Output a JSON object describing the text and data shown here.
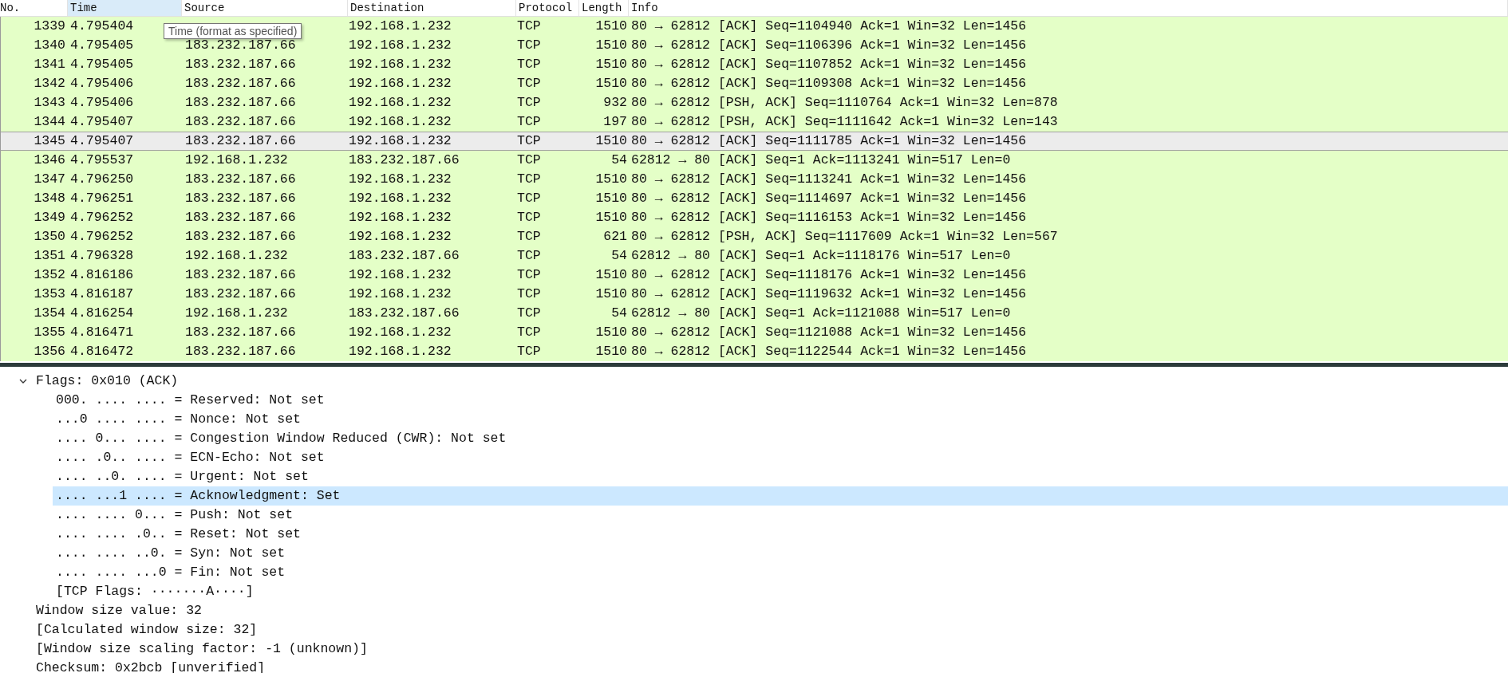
{
  "packet_list": {
    "columns": [
      {
        "label": "No.",
        "selected": false
      },
      {
        "label": "Time",
        "selected": true
      },
      {
        "label": "Source",
        "selected": false
      },
      {
        "label": "Destination",
        "selected": false
      },
      {
        "label": "Protocol",
        "selected": false
      },
      {
        "label": "Length",
        "selected": false
      },
      {
        "label": "Info",
        "selected": false
      }
    ],
    "tooltip": "Time (format as specified)",
    "rows": [
      {
        "no": "1339",
        "time": "4.795404",
        "destination": "192.168.1.232",
        "protocol": "TCP",
        "length": "1510",
        "info": "80 → 62812 [ACK] Seq=1104940 Ack=1 Win=32 Len=1456",
        "selected": false
      },
      {
        "no": "1340",
        "time": "4.795405",
        "source": "183.232.187.66",
        "destination": "192.168.1.232",
        "protocol": "TCP",
        "length": "1510",
        "info": "80 → 62812 [ACK] Seq=1106396 Ack=1 Win=32 Len=1456",
        "selected": false
      },
      {
        "no": "1341",
        "time": "4.795405",
        "source": "183.232.187.66",
        "destination": "192.168.1.232",
        "protocol": "TCP",
        "length": "1510",
        "info": "80 → 62812 [ACK] Seq=1107852 Ack=1 Win=32 Len=1456",
        "selected": false
      },
      {
        "no": "1342",
        "time": "4.795406",
        "source": "183.232.187.66",
        "destination": "192.168.1.232",
        "protocol": "TCP",
        "length": "1510",
        "info": "80 → 62812 [ACK] Seq=1109308 Ack=1 Win=32 Len=1456",
        "selected": false
      },
      {
        "no": "1343",
        "time": "4.795406",
        "source": "183.232.187.66",
        "destination": "192.168.1.232",
        "protocol": "TCP",
        "length": "932",
        "info": "80 → 62812 [PSH, ACK] Seq=1110764 Ack=1 Win=32 Len=878",
        "selected": false
      },
      {
        "no": "1344",
        "time": "4.795407",
        "source": "183.232.187.66",
        "destination": "192.168.1.232",
        "protocol": "TCP",
        "length": "197",
        "info": "80 → 62812 [PSH, ACK] Seq=1111642 Ack=1 Win=32 Len=143",
        "selected": false
      },
      {
        "no": "1345",
        "time": "4.795407",
        "source": "183.232.187.66",
        "destination": "192.168.1.232",
        "protocol": "TCP",
        "length": "1510",
        "info": "80 → 62812 [ACK] Seq=1111785 Ack=1 Win=32 Len=1456",
        "selected": true
      },
      {
        "no": "1346",
        "time": "4.795537",
        "source": "192.168.1.232",
        "destination": "183.232.187.66",
        "protocol": "TCP",
        "length": "54",
        "info": "62812 → 80 [ACK] Seq=1 Ack=1113241 Win=517 Len=0",
        "selected": false
      },
      {
        "no": "1347",
        "time": "4.796250",
        "source": "183.232.187.66",
        "destination": "192.168.1.232",
        "protocol": "TCP",
        "length": "1510",
        "info": "80 → 62812 [ACK] Seq=1113241 Ack=1 Win=32 Len=1456",
        "selected": false
      },
      {
        "no": "1348",
        "time": "4.796251",
        "source": "183.232.187.66",
        "destination": "192.168.1.232",
        "protocol": "TCP",
        "length": "1510",
        "info": "80 → 62812 [ACK] Seq=1114697 Ack=1 Win=32 Len=1456",
        "selected": false
      },
      {
        "no": "1349",
        "time": "4.796252",
        "source": "183.232.187.66",
        "destination": "192.168.1.232",
        "protocol": "TCP",
        "length": "1510",
        "info": "80 → 62812 [ACK] Seq=1116153 Ack=1 Win=32 Len=1456",
        "selected": false
      },
      {
        "no": "1350",
        "time": "4.796252",
        "source": "183.232.187.66",
        "destination": "192.168.1.232",
        "protocol": "TCP",
        "length": "621",
        "info": "80 → 62812 [PSH, ACK] Seq=1117609 Ack=1 Win=32 Len=567",
        "selected": false
      },
      {
        "no": "1351",
        "time": "4.796328",
        "source": "192.168.1.232",
        "destination": "183.232.187.66",
        "protocol": "TCP",
        "length": "54",
        "info": "62812 → 80 [ACK] Seq=1 Ack=1118176 Win=517 Len=0",
        "selected": false
      },
      {
        "no": "1352",
        "time": "4.816186",
        "source": "183.232.187.66",
        "destination": "192.168.1.232",
        "protocol": "TCP",
        "length": "1510",
        "info": "80 → 62812 [ACK] Seq=1118176 Ack=1 Win=32 Len=1456",
        "selected": false
      },
      {
        "no": "1353",
        "time": "4.816187",
        "source": "183.232.187.66",
        "destination": "192.168.1.232",
        "protocol": "TCP",
        "length": "1510",
        "info": "80 → 62812 [ACK] Seq=1119632 Ack=1 Win=32 Len=1456",
        "selected": false
      },
      {
        "no": "1354",
        "time": "4.816254",
        "source": "192.168.1.232",
        "destination": "183.232.187.66",
        "protocol": "TCP",
        "length": "54",
        "info": "62812 → 80 [ACK] Seq=1 Ack=1121088 Win=517 Len=0",
        "selected": false
      },
      {
        "no": "1355",
        "time": "4.816471",
        "source": "183.232.187.66",
        "destination": "192.168.1.232",
        "protocol": "TCP",
        "length": "1510",
        "info": "80 → 62812 [ACK] Seq=1121088 Ack=1 Win=32 Len=1456",
        "selected": false
      },
      {
        "no": "1356",
        "time": "4.816472",
        "source": "183.232.187.66",
        "destination": "192.168.1.232",
        "protocol": "TCP",
        "length": "1510",
        "info": "80 → 62812 [ACK] Seq=1122544 Ack=1 Win=32 Len=1456",
        "selected": false
      }
    ]
  },
  "details": [
    {
      "text": "Flags: 0x010 (ACK)",
      "expanded": true,
      "selected": false,
      "children": [
        {
          "text": "000. .... .... = Reserved: Not set",
          "selected": false
        },
        {
          "text": "...0 .... .... = Nonce: Not set",
          "selected": false
        },
        {
          "text": ".... 0... .... = Congestion Window Reduced (CWR): Not set",
          "selected": false
        },
        {
          "text": ".... .0.. .... = ECN-Echo: Not set",
          "selected": false
        },
        {
          "text": ".... ..0. .... = Urgent: Not set",
          "selected": false
        },
        {
          "text": ".... ...1 .... = Acknowledgment: Set",
          "selected": true
        },
        {
          "text": ".... .... 0... = Push: Not set",
          "selected": false
        },
        {
          "text": ".... .... .0.. = Reset: Not set",
          "selected": false
        },
        {
          "text": ".... .... ..0. = Syn: Not set",
          "selected": false
        },
        {
          "text": ".... .... ...0 = Fin: Not set",
          "selected": false
        },
        {
          "text": "[TCP Flags: ·······A····]",
          "selected": false
        }
      ]
    },
    {
      "text": "Window size value: 32",
      "selected": false
    },
    {
      "text": "[Calculated window size: 32]",
      "selected": false
    },
    {
      "text": "[Window size scaling factor: -1 (unknown)]",
      "selected": false
    },
    {
      "text": "Checksum: 0x2bcb [unverified]",
      "selected": false
    }
  ]
}
